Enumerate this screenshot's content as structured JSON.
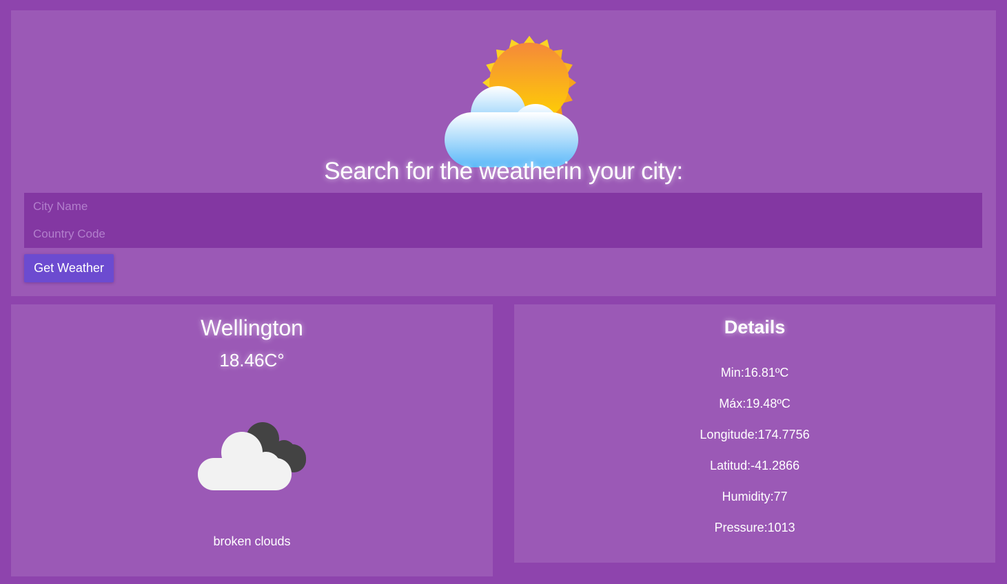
{
  "search": {
    "title": "Search for the weatherin your city:",
    "city_placeholder": "City Name",
    "country_placeholder": "Country Code",
    "button_label": "Get Weather",
    "hero_icon": "sun-behind-cloud-icon"
  },
  "weather": {
    "city": "Wellington",
    "temperature": "18.46C°",
    "icon": "broken-clouds-icon",
    "description": "broken clouds"
  },
  "details": {
    "title": "Details",
    "min": "Min:16.81ºC",
    "max": "Máx:19.48ºC",
    "longitude": "Longitude:174.7756",
    "latitude": "Latitud:-41.2866",
    "humidity": "Humidity:77",
    "pressure": "Pressure:1013"
  },
  "colors": {
    "page_background": "#8e44ad",
    "card_background": "#9b59b6",
    "input_background": "#8337a2",
    "button_background": "#6c4bd0"
  }
}
